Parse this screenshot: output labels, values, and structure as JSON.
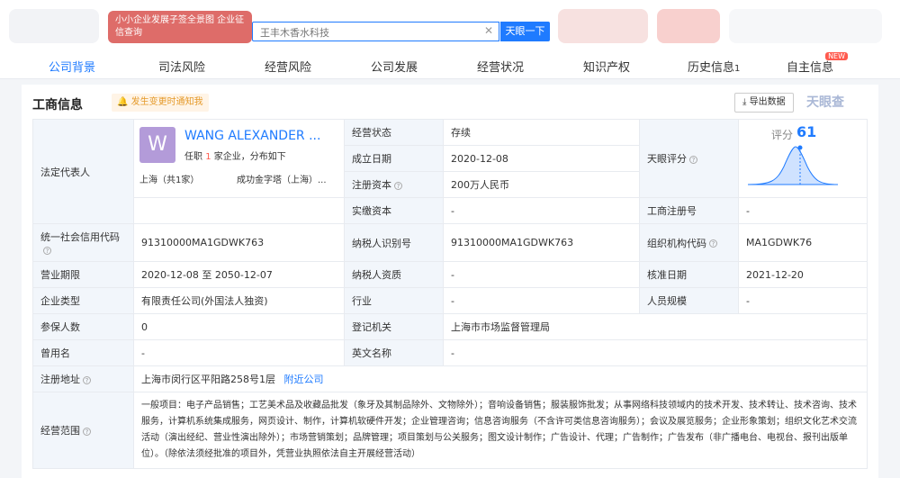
{
  "header": {
    "logo_text": "小小企业发展子签全景图 企业征信查询",
    "search_value": "王丰木香水科技",
    "search_button": "天眼一下"
  },
  "nav": {
    "tabs": [
      {
        "label": "公司背景",
        "active": true
      },
      {
        "label": "司法风险"
      },
      {
        "label": "经营风险"
      },
      {
        "label": "公司发展"
      },
      {
        "label": "经营状况"
      },
      {
        "label": "知识产权"
      },
      {
        "label": "历史信息",
        "count": "1"
      },
      {
        "label": "自主信息",
        "badge": "NEW"
      }
    ]
  },
  "section": {
    "title": "工商信息",
    "notice": "发生变更时通知我",
    "export_label": "导出数据",
    "brand": "天眼查"
  },
  "rep": {
    "label": "法定代表人",
    "avatar_letter": "W",
    "name": "WANG ALEXANDER ...",
    "sub_prefix": "任职",
    "sub_count": "1",
    "sub_suffix": "家企业，分布如下",
    "loc1": "上海（共1家）",
    "loc2": "成功金字塔（上海）..."
  },
  "rows": {
    "status_label": "经营状态",
    "status_value": "存续",
    "founded_label": "成立日期",
    "founded_value": "2020-12-08",
    "score_label": "天眼评分",
    "score_title": "评分",
    "score_value": "61",
    "capital_label": "注册资本",
    "capital_value": "200万人民币",
    "paid_label": "实缴资本",
    "paid_value": "-",
    "regno_label": "工商注册号",
    "regno_value": "-",
    "credit_label": "统一社会信用代码",
    "credit_value": "91310000MA1GDWK763",
    "taxid_label": "纳税人识别号",
    "taxid_value": "91310000MA1GDWK763",
    "orgcode_label": "组织机构代码",
    "orgcode_value": "MA1GDWK76",
    "term_label": "营业期限",
    "term_value": "2020-12-08 至 2050-12-07",
    "taxqual_label": "纳税人资质",
    "taxqual_value": "-",
    "approve_label": "核准日期",
    "approve_value": "2021-12-20",
    "type_label": "企业类型",
    "type_value": "有限责任公司(外国法人独资)",
    "industry_label": "行业",
    "industry_value": "-",
    "staff_label": "人员规模",
    "staff_value": "-",
    "insured_label": "参保人数",
    "insured_value": "0",
    "authority_label": "登记机关",
    "authority_value": "上海市市场监督管理局",
    "former_label": "曾用名",
    "former_value": "-",
    "english_label": "英文名称",
    "english_value": "-",
    "address_label": "注册地址",
    "address_value": "上海市闵行区平阳路258号1层",
    "address_link": "附近公司",
    "scope_label": "经营范围",
    "scope_value": "一般项目：电子产品销售；工艺美术品及收藏品批发（象牙及其制品除外、文物除外）；音响设备销售；服装服饰批发；从事网络科技领域内的技术开发、技术转让、技术咨询、技术服务，计算机系统集成服务，网页设计、制作，计算机软硬件开发；企业管理咨询；信息咨询服务（不含许可类信息咨询服务）；会议及展览服务；企业形象策划；组织文化艺术交流活动（演出经纪、营业性演出除外）；市场营销策划；品牌管理；项目策划与公关服务；图文设计制作；广告设计、代理；广告制作；广告发布（非广播电台、电视台、报刊出版单位）。（除依法须经批准的项目外，凭营业执照依法自主开展经营活动）"
  }
}
